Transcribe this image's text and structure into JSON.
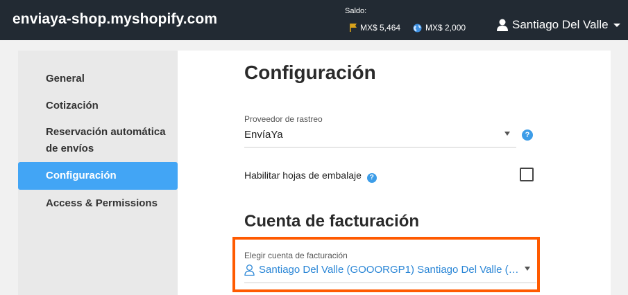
{
  "header": {
    "shop_title": "enviaya-shop.myshopify.com",
    "saldo_label": "Saldo:",
    "balance_primary": "MX$ 5,464",
    "balance_secondary": "MX$ 2,000",
    "user_name": "Santiago Del Valle",
    "icons": {
      "flag": "flag-icon",
      "globe": "globe-icon",
      "user": "user-icon",
      "caret": "caret-down-icon"
    }
  },
  "sidebar": {
    "items": [
      {
        "label": "General",
        "active": false
      },
      {
        "label": "Cotización",
        "active": false
      },
      {
        "label": "Reservación automática",
        "label2": "de envíos",
        "active": false
      },
      {
        "label": "Configuración",
        "active": true
      },
      {
        "label": "Access & Permissions",
        "active": false
      }
    ]
  },
  "main": {
    "page_title": "Configuración",
    "tracking_provider": {
      "label": "Proveedor de rastreo",
      "value": "EnvíaYa",
      "help": "?"
    },
    "packing_slips": {
      "label": "Habilitar hojas de embalaje",
      "help": "?",
      "checked": false
    },
    "billing_section_title": "Cuenta de facturación",
    "billing_account": {
      "label": "Elegir cuenta de facturación",
      "value": "Santiago Del Valle (GOOORGP1) Santiago Del Valle (…"
    }
  },
  "colors": {
    "topbar": "#222a33",
    "accent": "#42a5f5",
    "link": "#2a86d6",
    "highlight": "#ff5a00"
  }
}
